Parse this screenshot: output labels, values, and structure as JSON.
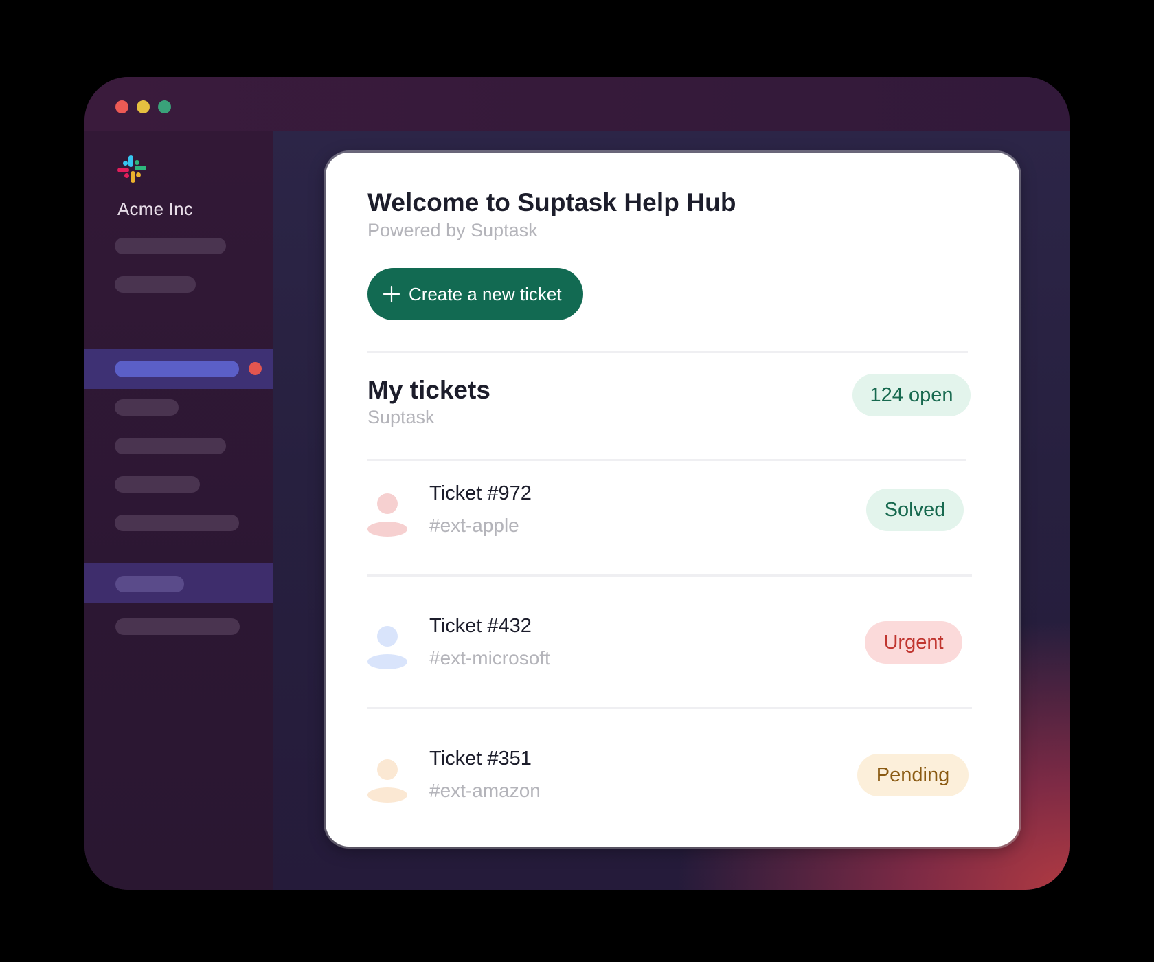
{
  "workspace": {
    "name": "Acme Inc"
  },
  "sidebar": {
    "logo_icon": "slack-logo-icon",
    "notification_color": "#e3564f"
  },
  "hub": {
    "title": "Welcome to Suptask Help Hub",
    "subtitle": "Powered by Suptask",
    "create_button_label": "Create a new ticket",
    "create_button_icon": "plus-icon"
  },
  "tickets_section": {
    "title": "My tickets",
    "subtitle": "Suptask",
    "open_count_label": "124 open"
  },
  "tickets": [
    {
      "name": "Ticket #972",
      "channel": "#ext-apple",
      "status": "Solved",
      "avatar_color": "#f6d0d0",
      "status_bg": "#e3f4ec",
      "status_color": "#17694f"
    },
    {
      "name": "Ticket #432",
      "channel": "#ext-microsoft",
      "status": "Urgent",
      "avatar_color": "#d9e4fb",
      "status_bg": "#fbdada",
      "status_color": "#c0352f"
    },
    {
      "name": "Ticket #351",
      "channel": "#ext-amazon",
      "status": "Pending",
      "avatar_color": "#fbe8d3",
      "status_bg": "#fcefda",
      "status_color": "#8a5a12"
    }
  ],
  "colors": {
    "accent": "#126a52",
    "window_bg": "#331935",
    "active_nav": "#5b5fc7"
  }
}
